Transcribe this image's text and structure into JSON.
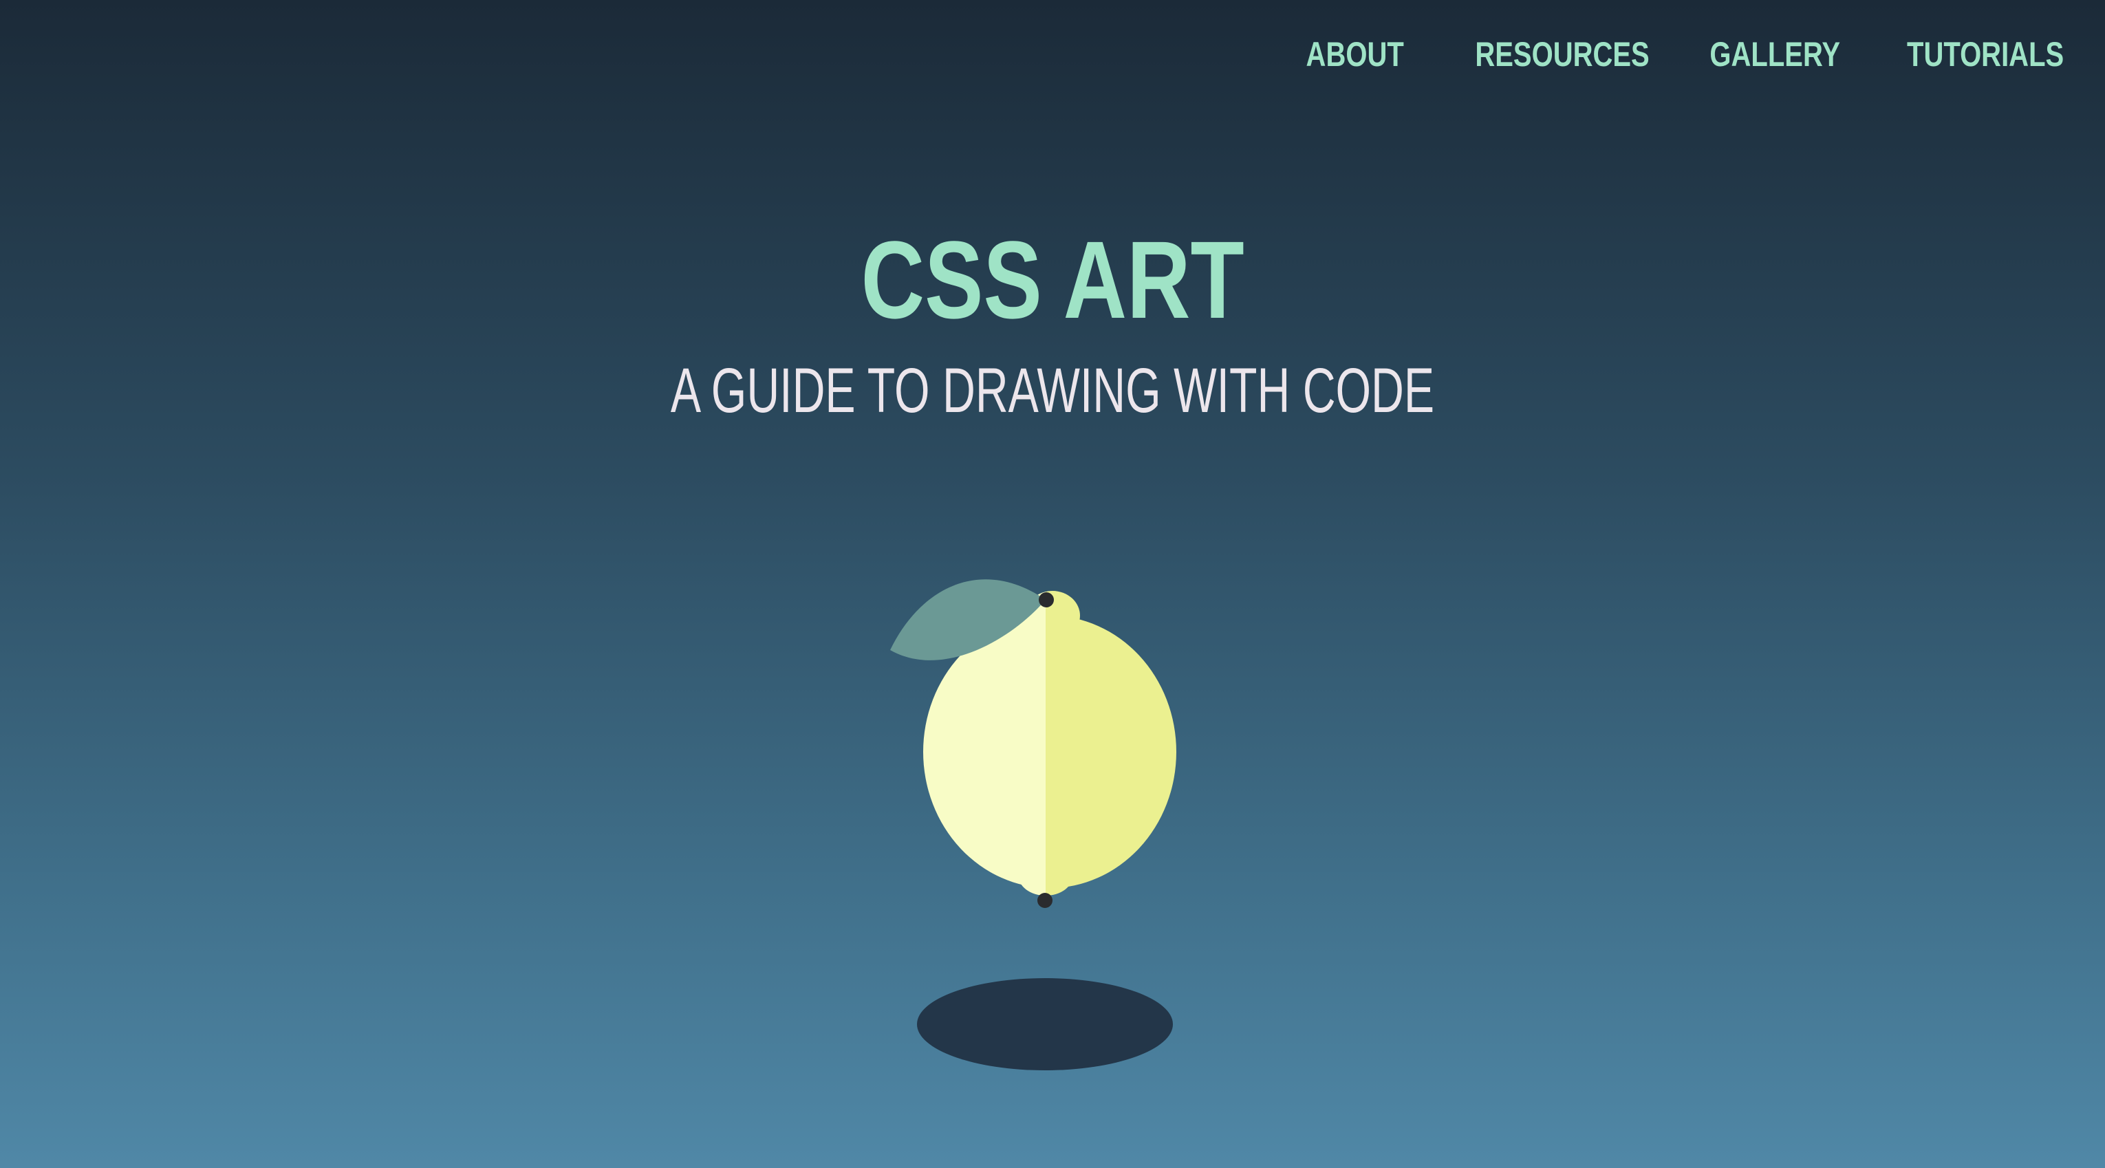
{
  "nav": {
    "items": [
      {
        "label": "ABOUT"
      },
      {
        "label": "RESOURCES"
      },
      {
        "label": "GALLERY"
      },
      {
        "label": "TUTORIALS"
      }
    ]
  },
  "hero": {
    "title": "CSS ART",
    "subtitle": "A GUIDE TO DRAWING WITH CODE"
  },
  "art": {
    "subject": "lemon-icon",
    "colors": {
      "lemon_light": "#f8fcc6",
      "lemon_dark": "#ebf090",
      "leaf": "#6b9995",
      "dots": "#2a2b2e",
      "shadow": "#233649"
    }
  },
  "theme": {
    "accent": "#9fe3c6",
    "subtitle_color": "#ece6ec",
    "background_top": "#1b2a38",
    "background_bottom": "#5088a7"
  }
}
